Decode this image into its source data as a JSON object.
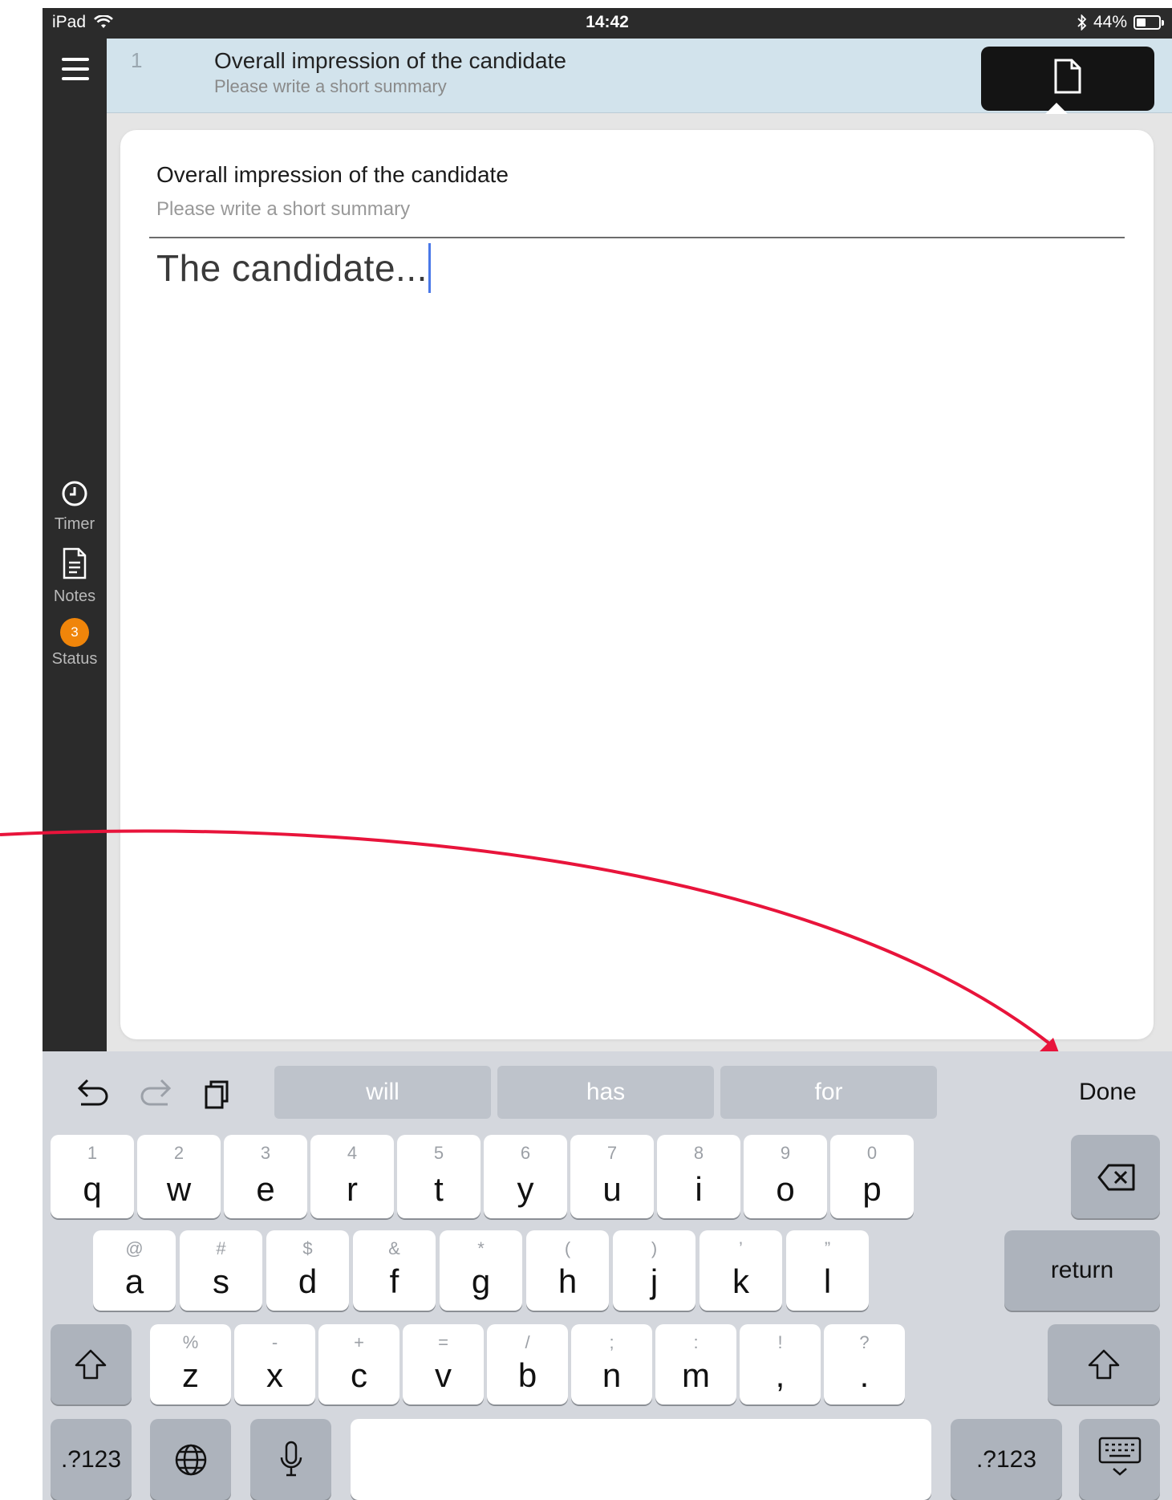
{
  "status_bar": {
    "carrier": "iPad",
    "time": "14:42",
    "battery": "44%",
    "battery_level": 0.44
  },
  "sidebar": {
    "items": [
      {
        "label": "Timer",
        "icon": "clock-icon"
      },
      {
        "label": "Notes",
        "icon": "notes-icon"
      },
      {
        "label": "Status",
        "icon": "status-badge",
        "badge": "3"
      }
    ]
  },
  "question": {
    "number": "1",
    "title": "Overall impression of the candidate",
    "subtitle": "Please write a short summary"
  },
  "card": {
    "title": "Overall impression of the candidate",
    "subtitle": "Please write a short summary",
    "text": "The candidate..."
  },
  "keyboard": {
    "suggestions": [
      "will",
      "has",
      "for"
    ],
    "done_label": "Done",
    "row1": [
      [
        "1",
        "q"
      ],
      [
        "2",
        "w"
      ],
      [
        "3",
        "e"
      ],
      [
        "4",
        "r"
      ],
      [
        "5",
        "t"
      ],
      [
        "6",
        "y"
      ],
      [
        "7",
        "u"
      ],
      [
        "8",
        "i"
      ],
      [
        "9",
        "o"
      ],
      [
        "0",
        "p"
      ]
    ],
    "row2": [
      [
        "@",
        "a"
      ],
      [
        "#",
        "s"
      ],
      [
        "$",
        "d"
      ],
      [
        "&",
        "f"
      ],
      [
        "*",
        "g"
      ],
      [
        "(",
        "h"
      ],
      [
        ")",
        "j"
      ],
      [
        "’",
        "k"
      ],
      [
        "”",
        "l"
      ]
    ],
    "row3": [
      [
        "%",
        "z"
      ],
      [
        "-",
        "x"
      ],
      [
        "+",
        "c"
      ],
      [
        "=",
        "v"
      ],
      [
        "/",
        "b"
      ],
      [
        ";",
        "n"
      ],
      [
        ":",
        "m"
      ],
      [
        "!",
        ","
      ],
      [
        "?",
        "."
      ]
    ],
    "return_label": "return",
    "numbers_label": ".?123"
  },
  "colors": {
    "accent": "#f0850a",
    "annotation_arrow": "#e8143b",
    "cursor": "#4a78e8",
    "header_bg": "#d2e3ec"
  }
}
